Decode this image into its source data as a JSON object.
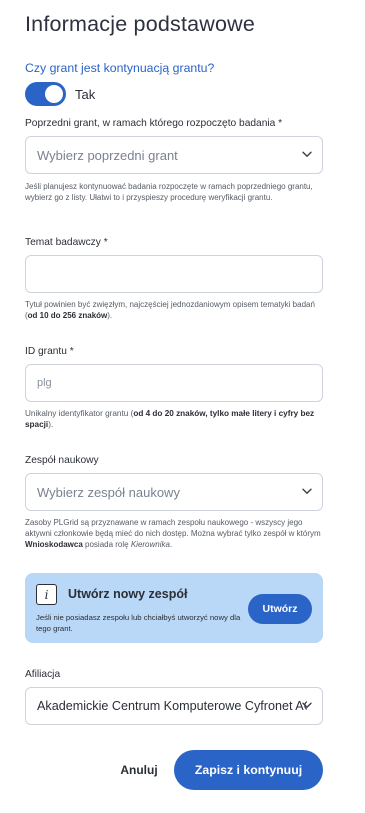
{
  "page": {
    "title": "Informacje podstawowe"
  },
  "continuation": {
    "question": "Czy grant jest kontynuacją grantu?",
    "toggle_label": "Tak",
    "toggle_on": true
  },
  "previous_grant": {
    "label": "Poprzedni grant, w ramach którego rozpoczęto badania *",
    "placeholder": "Wybierz poprzedni grant",
    "hint": "Jeśli planujesz kontynuować badania rozpoczęte w ramach poprzedniego grantu, wybierz go z listy. Ułatwi to i przyspieszy procedurę weryfikacji grantu."
  },
  "research_topic": {
    "label": "Temat badawczy *",
    "value": "",
    "hint_prefix": "Tytuł powinien być zwięzłym, najczęściej jednozdaniowym opisem tematyki badań (",
    "hint_bold": "od 10 do 256 znaków",
    "hint_suffix": ")."
  },
  "grant_id": {
    "label": "ID grantu *",
    "placeholder": "plg",
    "hint_prefix": "Unikalny identyfikator grantu (",
    "hint_bold": "od 4 do 20 znaków, tylko małe litery i cyfry bez spacji",
    "hint_suffix": ")."
  },
  "team": {
    "label": "Zespół naukowy",
    "placeholder": "Wybierz zespół naukowy",
    "hint_prefix": "Zasoby PLGrid są przyznawane w ramach zespołu naukowego - wszyscy jego aktywni członkowie będą mieć do nich dostęp. Można wybrać tylko zespół w którym ",
    "hint_bold": "Wnioskodawca",
    "hint_middle": " posiada rolę ",
    "hint_italic": "Kierownika",
    "hint_suffix": "."
  },
  "new_team": {
    "icon": "info-icon",
    "icon_glyph": "i",
    "title": "Utwórz nowy zespół",
    "text": "Jeśli nie posiadasz zespołu lub chciałbyś utworzyć nowy dla tego grant.",
    "button": "Utwórz"
  },
  "affiliation": {
    "label": "Afiliacja",
    "value": "Akademickie Centrum Komputerowe Cyfronet AGH"
  },
  "actions": {
    "cancel": "Anuluj",
    "save": "Zapisz i kontynuuj"
  },
  "colors": {
    "accent": "#2a64c6",
    "info_bg": "#b9d7f7",
    "border": "#cfd4dc"
  }
}
